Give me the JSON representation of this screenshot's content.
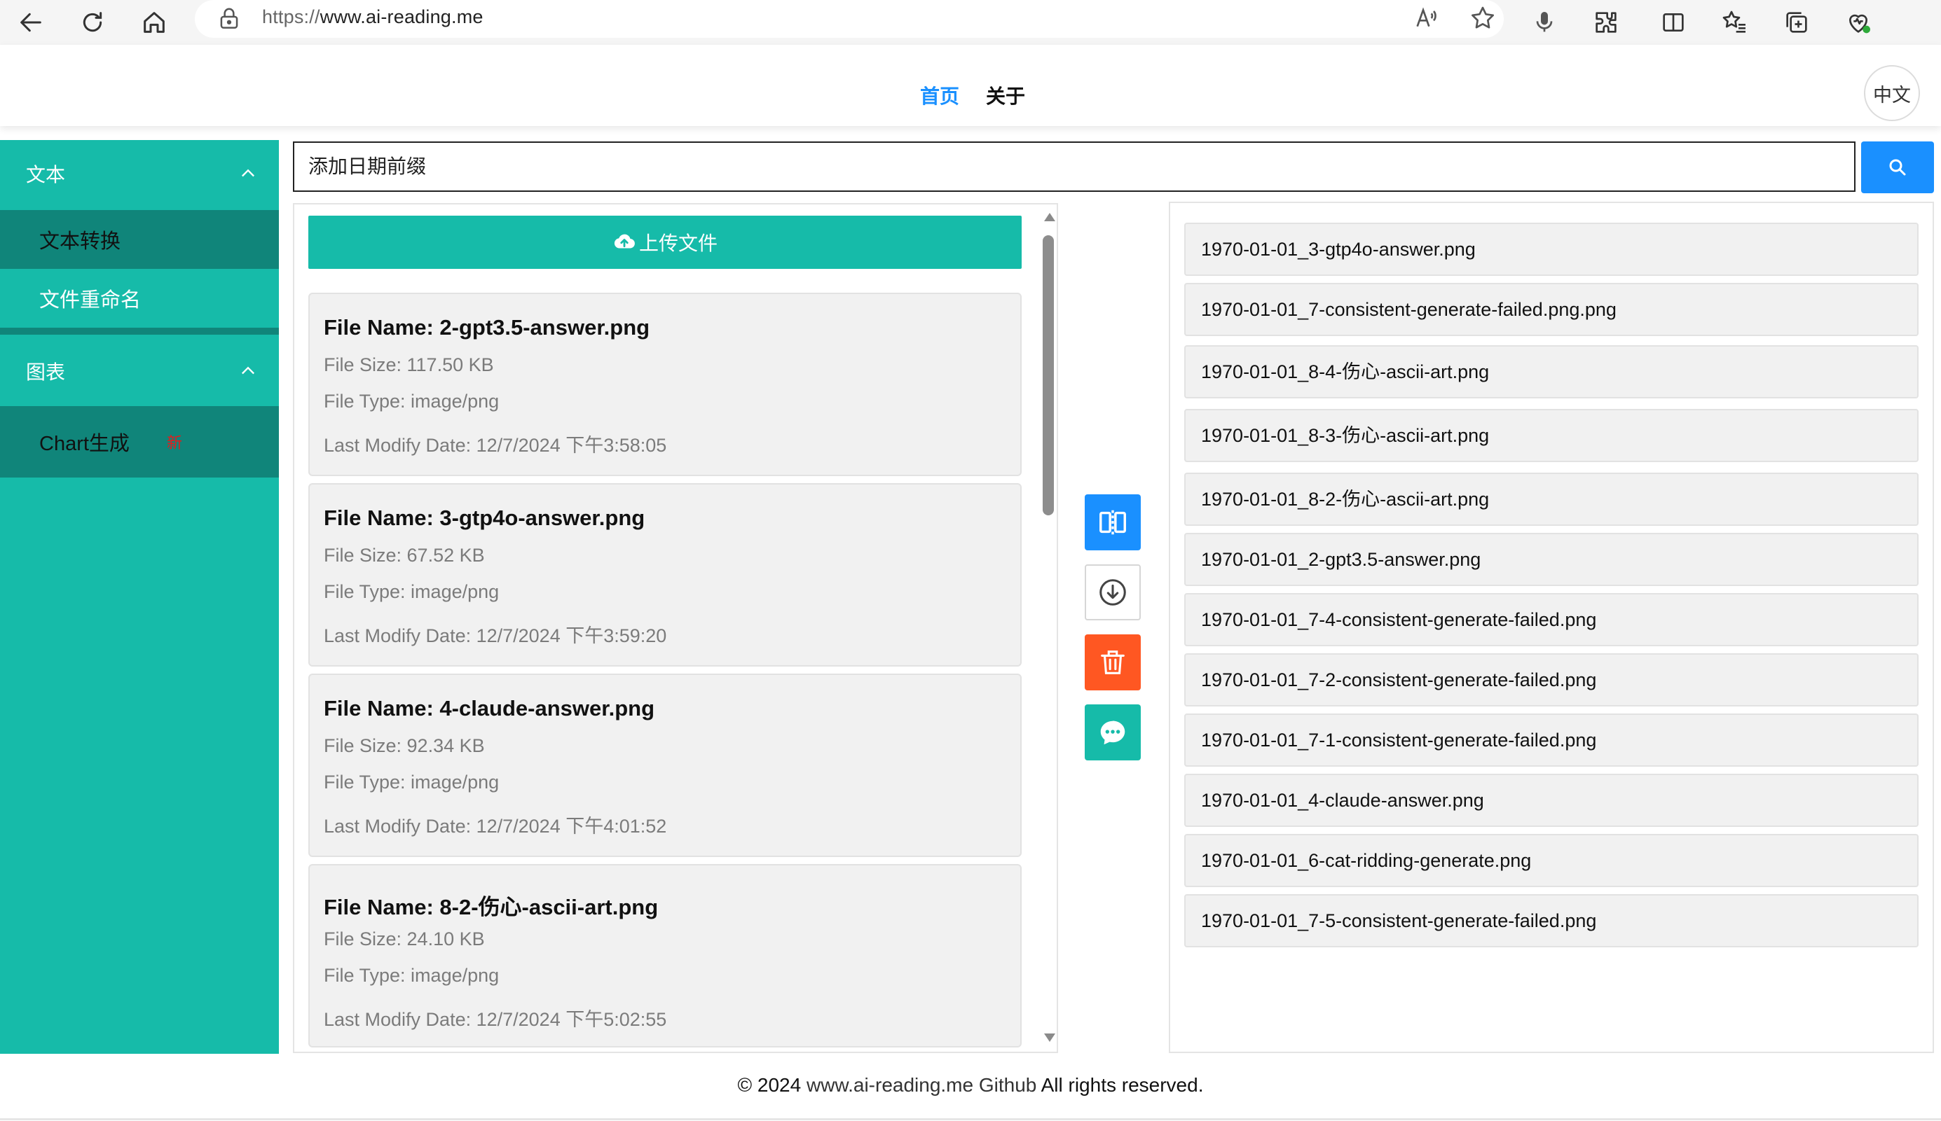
{
  "browser": {
    "url_protocol": "https://",
    "url_host": "www.ai-reading.me"
  },
  "header": {
    "nav": [
      {
        "label": "首页",
        "active": true
      },
      {
        "label": "关于",
        "active": false
      }
    ],
    "lang_button": "中文"
  },
  "sidebar": {
    "groups": [
      {
        "label": "文本",
        "expanded": true,
        "items": [
          {
            "label": "文本转换",
            "selected": true
          },
          {
            "label": "文件重命名",
            "selected": false
          }
        ]
      },
      {
        "label": "图表",
        "expanded": true,
        "items": [
          {
            "label": "Chart生成",
            "badge": "新",
            "selected": true
          }
        ]
      }
    ]
  },
  "search": {
    "value": "添加日期前缀"
  },
  "upload": {
    "label": "上传文件"
  },
  "files": [
    {
      "name": "File Name: 2-gpt3.5-answer.png",
      "size": "File Size: 117.50 KB",
      "type": "File Type: image/png",
      "date": "Last Modify Date: 12/7/2024 下午3:58:05"
    },
    {
      "name": "File Name: 3-gtp4o-answer.png",
      "size": "File Size: 67.52 KB",
      "type": "File Type: image/png",
      "date": "Last Modify Date: 12/7/2024 下午3:59:20"
    },
    {
      "name": "File Name: 4-claude-answer.png",
      "size": "File Size: 92.34 KB",
      "type": "File Type: image/png",
      "date": "Last Modify Date: 12/7/2024 下午4:01:52"
    },
    {
      "name": "File Name: 8-2-伤心-ascii-art.png",
      "size": "File Size: 24.10 KB",
      "type": "File Type: image/png",
      "date": "Last Modify Date: 12/7/2024 下午5:02:55"
    }
  ],
  "actions": {
    "colors": {
      "compare": "#1a90ff",
      "download": "#ffffff",
      "delete": "#ff5722",
      "chat": "#16bba9"
    }
  },
  "outputs": [
    "1970-01-01_3-gtp4o-answer.png",
    "1970-01-01_7-consistent-generate-failed.png.png",
    "1970-01-01_8-4-伤心-ascii-art.png",
    "1970-01-01_8-3-伤心-ascii-art.png",
    "1970-01-01_8-2-伤心-ascii-art.png",
    "1970-01-01_2-gpt3.5-answer.png",
    "1970-01-01_7-4-consistent-generate-failed.png",
    "1970-01-01_7-2-consistent-generate-failed.png",
    "1970-01-01_7-1-consistent-generate-failed.png",
    "1970-01-01_4-claude-answer.png",
    "1970-01-01_6-cat-ridding-generate.png",
    "1970-01-01_7-5-consistent-generate-failed.png"
  ],
  "footer": {
    "copyright": "© 2024",
    "site": "www.ai-reading.me",
    "github": "Github",
    "rights": "All rights reserved."
  },
  "theme": {
    "primary": "#16bba9",
    "primary_dark": "#10857a",
    "accent_blue": "#1a90ff",
    "danger": "#ff5722"
  }
}
